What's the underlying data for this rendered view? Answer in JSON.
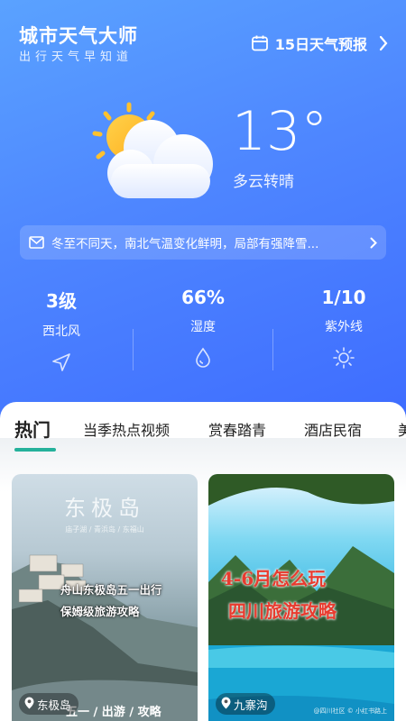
{
  "app": {
    "title": "城市天气大师",
    "subtitle": "出行天气早知道",
    "forecast_link": "15日天气预报"
  },
  "current": {
    "temperature": "13°",
    "condition": "多云转晴"
  },
  "notice": {
    "text": "冬至不同天，南北气温变化鲜明，局部有强降雪..."
  },
  "stats": [
    {
      "value": "3级",
      "label": "西北风",
      "icon": "navigation-arrow-icon"
    },
    {
      "value": "66%",
      "label": "湿度",
      "icon": "water-drop-icon"
    },
    {
      "value": "1/10",
      "label": "紫外线",
      "icon": "sun-icon"
    }
  ],
  "tabs": [
    {
      "label": "热门",
      "active": true
    },
    {
      "label": "当季热点视频"
    },
    {
      "label": "赏春踏青"
    },
    {
      "label": "酒店民宿"
    },
    {
      "label": "美"
    }
  ],
  "cards": [
    {
      "title": "东极岛",
      "small_text": "庙子湖 / 青浜岛 / 东福山",
      "line1": "舟山东极岛五一出行",
      "line2": "保姆级旅游攻略",
      "bottom_text": "五一 / 出游 / 攻略",
      "location": "东极岛"
    },
    {
      "title_line1": "4-6月怎么玩",
      "title_line2": "四川旅游攻略",
      "credit": "@四川社区 © 小红书路上",
      "location": "九寨沟"
    }
  ],
  "colors": {
    "hero_top": "#5aa2ff",
    "hero_bottom": "#3e6cff",
    "tab_accent": "#25b19b",
    "card2_title": "#e83b2f"
  }
}
